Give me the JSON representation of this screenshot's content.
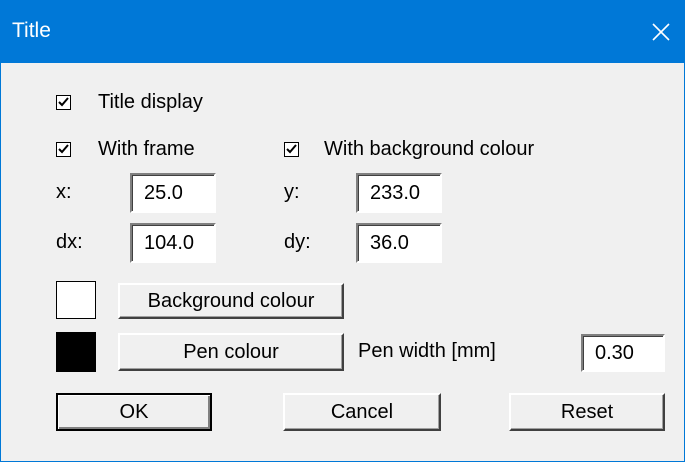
{
  "window": {
    "title": "Title",
    "titlebar_color": "#0078d7"
  },
  "checkboxes": {
    "title_display": {
      "label": "Title display",
      "checked": true
    },
    "with_frame": {
      "label": "With frame",
      "checked": true
    },
    "with_background_colour": {
      "label": "With background colour",
      "checked": true
    }
  },
  "fields": {
    "x": {
      "label": "x:",
      "value": "25.0"
    },
    "y": {
      "label": "y:",
      "value": "233.0"
    },
    "dx": {
      "label": "dx:",
      "value": "104.0"
    },
    "dy": {
      "label": "dy:",
      "value": "36.0"
    },
    "pen_width": {
      "label": "Pen width [mm]",
      "value": "0.30"
    }
  },
  "colours": {
    "background_swatch": "#ffffff",
    "pen_swatch": "#000000"
  },
  "buttons": {
    "background_colour": "Background colour",
    "pen_colour": "Pen colour",
    "ok": "OK",
    "cancel": "Cancel",
    "reset": "Reset"
  },
  "icons": {
    "close": "close-icon",
    "check": "checkmark-icon"
  }
}
